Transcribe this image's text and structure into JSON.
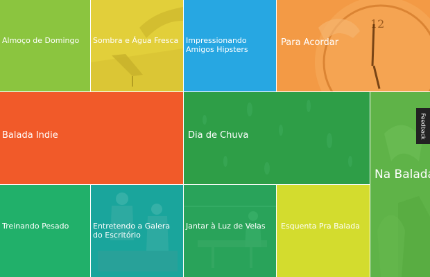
{
  "tiles": [
    {
      "id": "t1",
      "label": "Almoço de Domingo",
      "color": "#8bc53f"
    },
    {
      "id": "t2",
      "label": "Sombra e Água Fresca",
      "color": "#e2cf3a"
    },
    {
      "id": "t3",
      "label": "Impressionando Amigos Hipsters",
      "color": "#27a7e2"
    },
    {
      "id": "t4",
      "label": "Para Acordar",
      "color": "#f39a45"
    },
    {
      "id": "t5",
      "label": "Balada Indie",
      "color": "#f15a29"
    },
    {
      "id": "t6",
      "label": "Dia de Chuva",
      "color": "#2e9e47"
    },
    {
      "id": "t7",
      "label": "Na Balada",
      "color": "#5fb348"
    },
    {
      "id": "t8",
      "label": "Treinando Pesado",
      "color": "#21b06a"
    },
    {
      "id": "t9",
      "label": "Entretendo a Galera do Escritório",
      "color": "#1aa59c"
    },
    {
      "id": "t10",
      "label": "Jantar à Luz de Velas",
      "color": "#29a35a"
    },
    {
      "id": "t11",
      "label": "Esquenta Pra Balada",
      "color": "#d3dc2e"
    }
  ],
  "feedback": {
    "label": "Feedback"
  }
}
